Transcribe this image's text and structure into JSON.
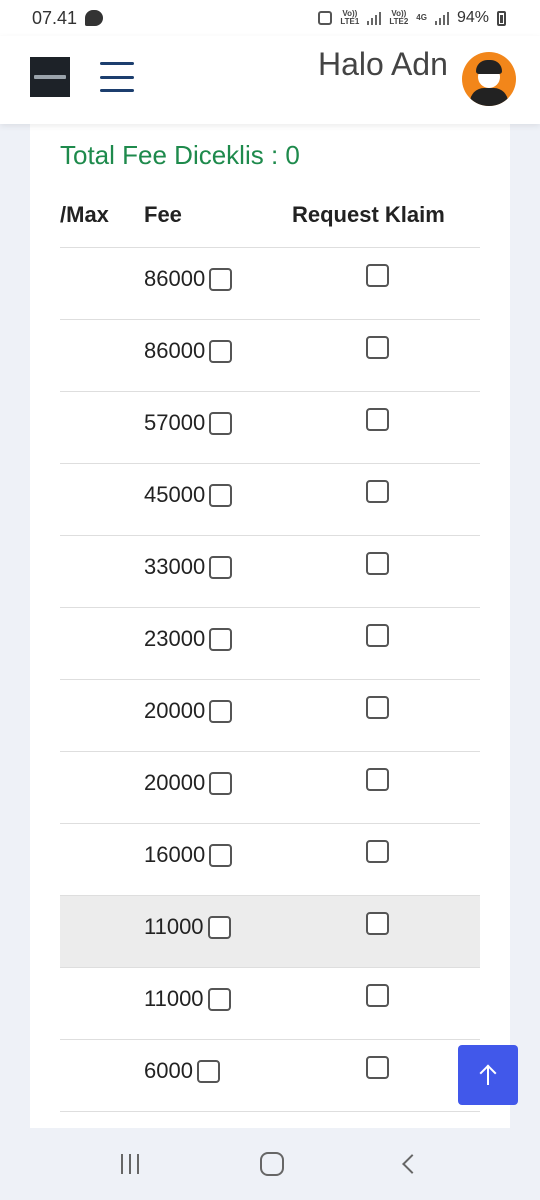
{
  "status_bar": {
    "time": "07.41",
    "battery": "94%",
    "sim1_top": "Vo))",
    "sim1_bottom": "LTE1",
    "sim2_top": "Vo))",
    "sim2_bottom": "LTE2",
    "network": "4G"
  },
  "header": {
    "greeting": "Halo Adn"
  },
  "summary": {
    "total_fee": "Total Fee Diceklis : 0"
  },
  "table": {
    "columns": [
      "/Max",
      "Fee",
      "Request Klaim"
    ],
    "rows": [
      {
        "fee": "86000"
      },
      {
        "fee": "86000"
      },
      {
        "fee": "57000"
      },
      {
        "fee": "45000"
      },
      {
        "fee": "33000"
      },
      {
        "fee": "23000"
      },
      {
        "fee": "20000"
      },
      {
        "fee": "20000"
      },
      {
        "fee": "16000"
      },
      {
        "fee": "11000"
      },
      {
        "fee": "11000"
      },
      {
        "fee": "6000"
      }
    ]
  },
  "colors": {
    "accent_green": "#1e8a4c",
    "scroll_button": "#4158ea",
    "menu_icon": "#1c3e6e",
    "avatar_bg": "#f2861a"
  }
}
